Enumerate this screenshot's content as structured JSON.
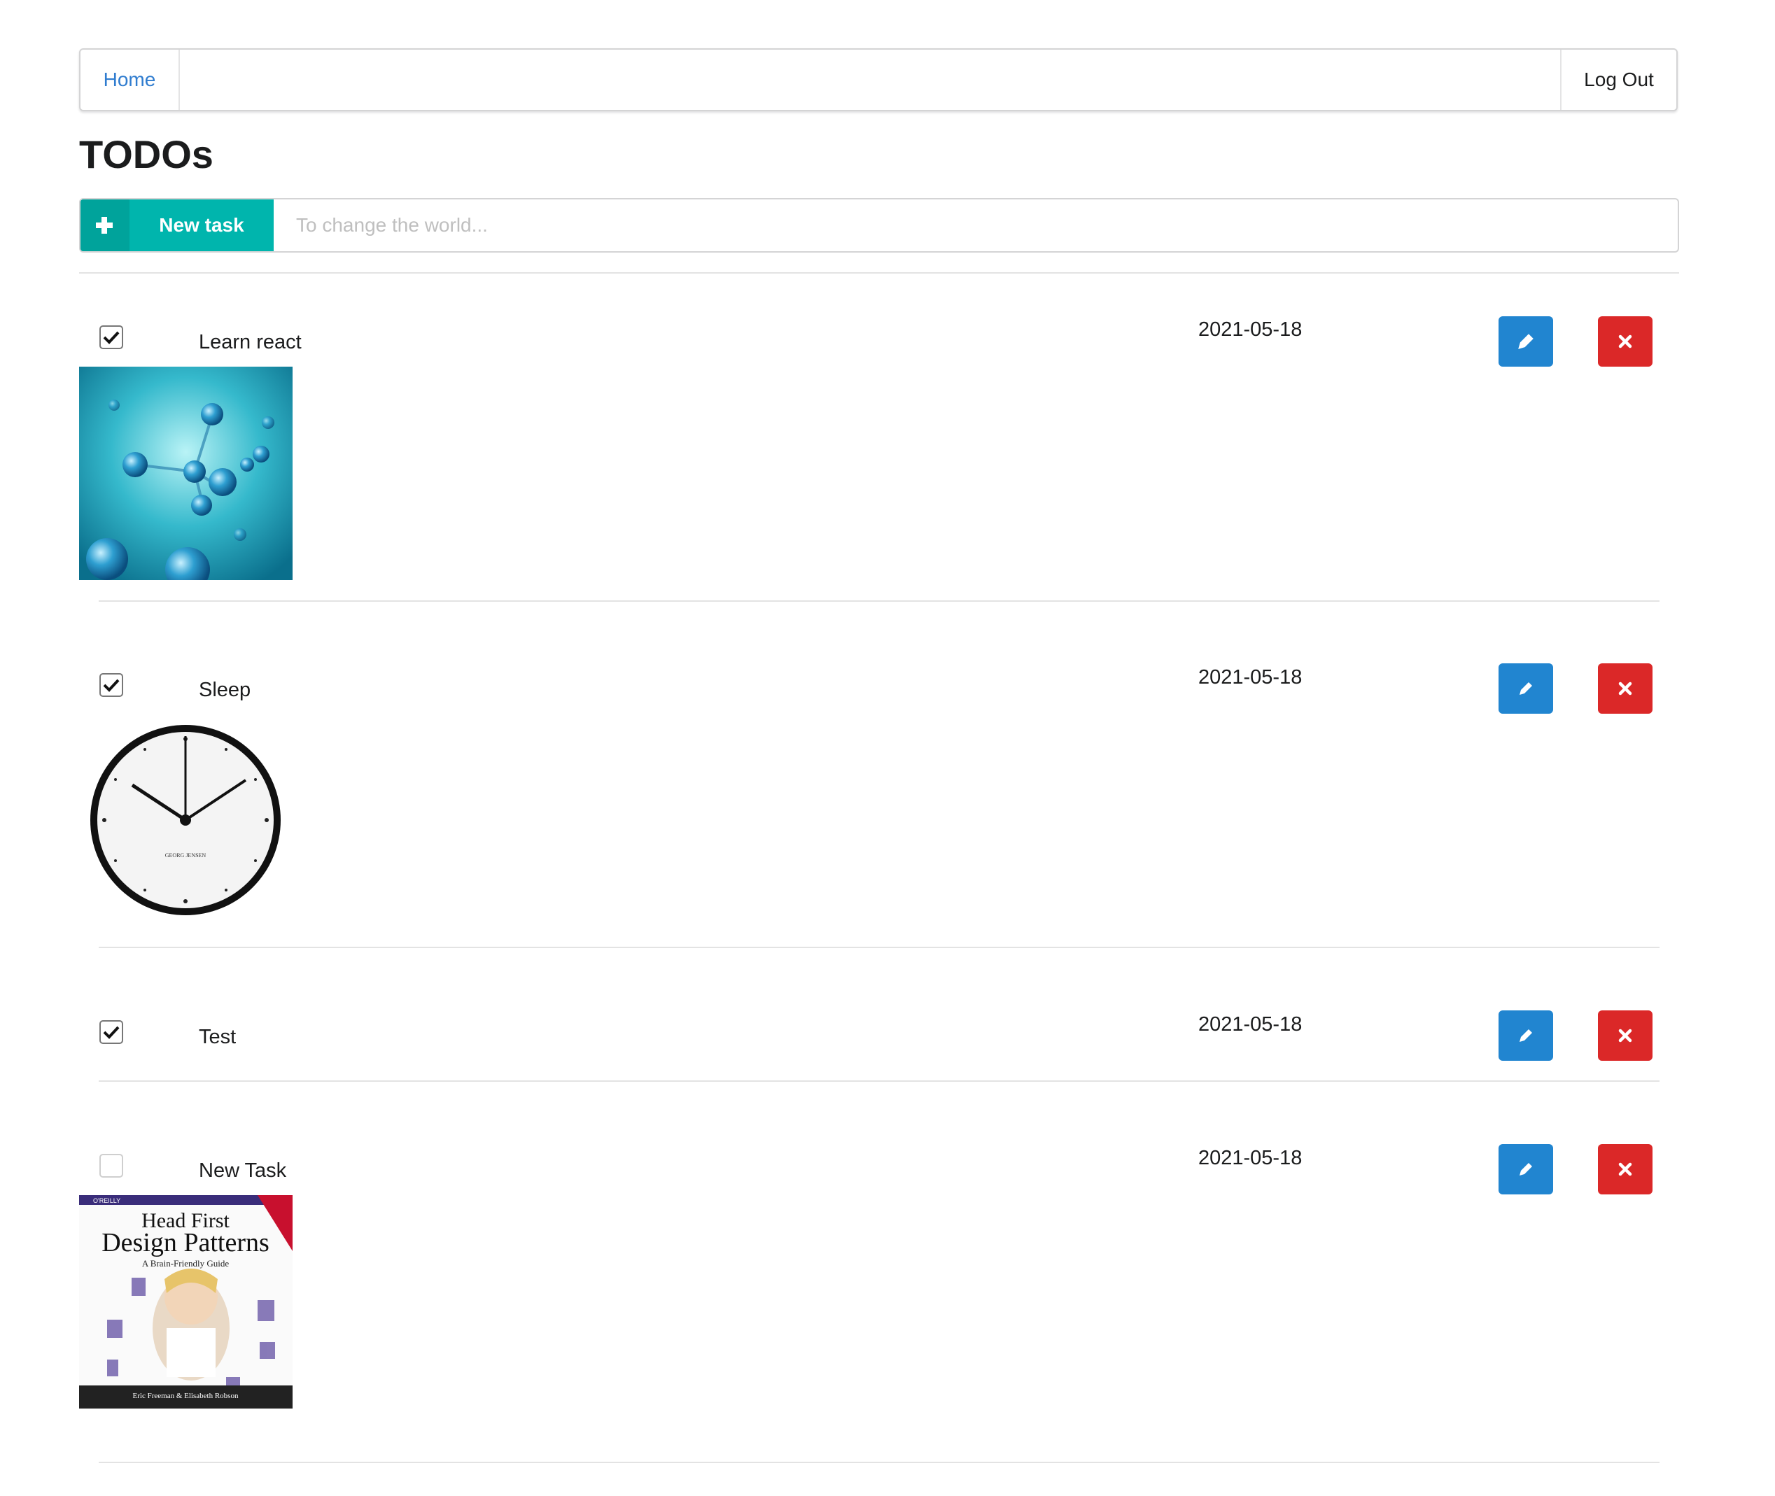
{
  "nav": {
    "home_label": "Home",
    "logout_label": "Log Out"
  },
  "page": {
    "title": "TODOs"
  },
  "new_task": {
    "button_label": "New task",
    "input_placeholder": "To change the world...",
    "input_value": "",
    "accent_color": "#00b5ad"
  },
  "todos": [
    {
      "title": "Learn react",
      "date": "2021-05-18",
      "done": true,
      "image": "molecule-image"
    },
    {
      "title": "Sleep",
      "date": "2021-05-18",
      "done": true,
      "image": "wall-clock-image",
      "image_text": "GEORG JENSEN"
    },
    {
      "title": "Test",
      "date": "2021-05-18",
      "done": true,
      "image": null
    },
    {
      "title": "New Task",
      "date": "2021-05-18",
      "done": false,
      "image": "book-cover-image",
      "book": {
        "publisher": "O'REILLY",
        "title_line1": "Head First",
        "title_line2": "Design Patterns",
        "subtitle": "A Brain-Friendly Guide",
        "authors": "Eric Freeman & Elisabeth Robson"
      }
    }
  ],
  "colors": {
    "edit_button": "#2185d0",
    "delete_button": "#db2828",
    "link": "#2f7ccf"
  },
  "icons": {
    "edit": "pencil-icon",
    "delete": "close-icon",
    "check": "checkmark-icon",
    "add": "plus-icon"
  }
}
